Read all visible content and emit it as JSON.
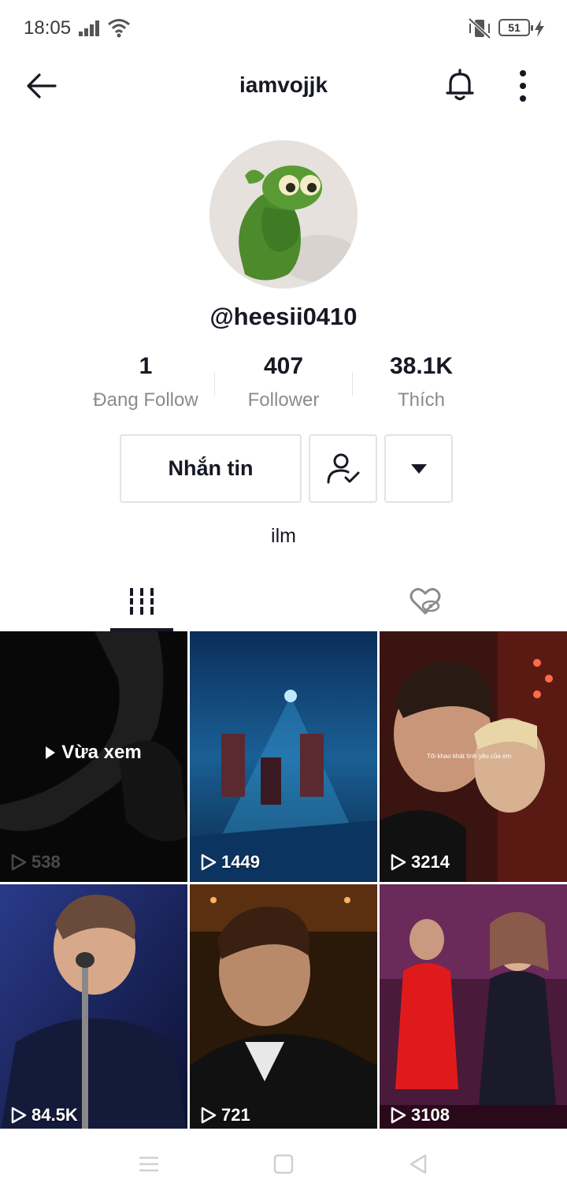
{
  "status_bar": {
    "time": "18:05",
    "battery": "51"
  },
  "header": {
    "title": "iamvojjk"
  },
  "profile": {
    "username": "@heesii0410",
    "bio": "ilm"
  },
  "stats": [
    {
      "value": "1",
      "label": "Đang Follow"
    },
    {
      "value": "407",
      "label": "Follower"
    },
    {
      "value": "38.1K",
      "label": "Thích"
    }
  ],
  "actions": {
    "message_label": "Nhắn tin"
  },
  "videos": [
    {
      "views": "538",
      "overlay": "Vừa xem"
    },
    {
      "views": "1449"
    },
    {
      "views": "3214",
      "caption": "Tôi khao khát tình yêu của em"
    },
    {
      "views": "84.5K"
    },
    {
      "views": "721"
    },
    {
      "views": "3108"
    }
  ],
  "colors": {
    "text": "#161823",
    "secondary": "#8a8b91",
    "border": "#e3e3e4"
  },
  "icons": {
    "back": "arrow-left-icon",
    "bell": "bell-icon",
    "more": "vertical-dots-icon",
    "follow": "user-check-icon",
    "dropdown": "triangle-down-icon",
    "videos_tab": "grid-bars-icon",
    "liked_tab": "heart-hidden-icon",
    "play": "play-outline-icon"
  }
}
